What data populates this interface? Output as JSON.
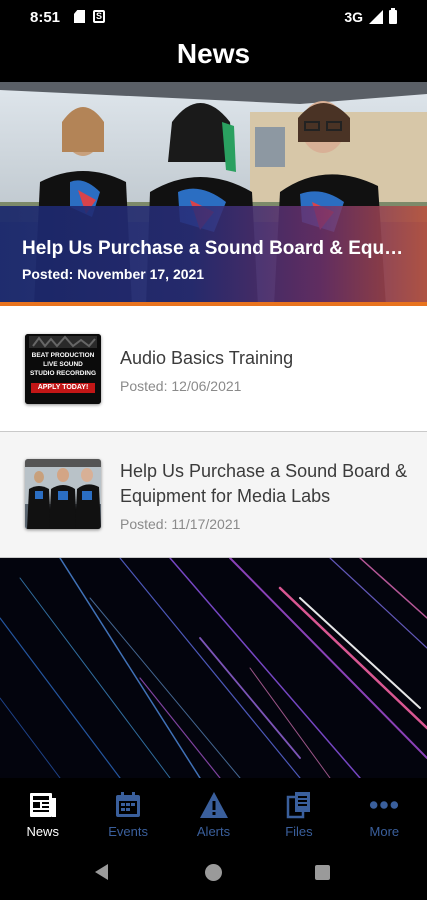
{
  "status_bar": {
    "time": "8:51",
    "network": "3G",
    "s_icon_letter": "S"
  },
  "header": {
    "title": "News"
  },
  "featured": {
    "title": "Help Us Purchase a Sound Board & Equipment for Media Labs",
    "date": "Posted: November 17, 2021"
  },
  "news_items": [
    {
      "title": "Audio Basics Training",
      "date": "Posted: 12/06/2021",
      "thumb_lines": [
        "BEAT PRODUCTION",
        "LIVE SOUND",
        "STUDIO RECORDING"
      ],
      "thumb_cta": "APPLY TODAY!"
    },
    {
      "title": "Help Us Purchase a Sound Board & Equipment for Media Labs",
      "date": "Posted: 11/17/2021"
    }
  ],
  "bottom_nav": [
    {
      "label": "News",
      "icon": "news-icon",
      "active": true
    },
    {
      "label": "Events",
      "icon": "calendar-icon",
      "active": false
    },
    {
      "label": "Alerts",
      "icon": "alert-icon",
      "active": false
    },
    {
      "label": "Files",
      "icon": "files-icon",
      "active": false
    },
    {
      "label": "More",
      "icon": "more-icon",
      "active": false
    }
  ],
  "colors": {
    "accent_orange": "#e8731e",
    "nav_inactive": "#3a5f9c",
    "nav_active": "#ffffff"
  }
}
